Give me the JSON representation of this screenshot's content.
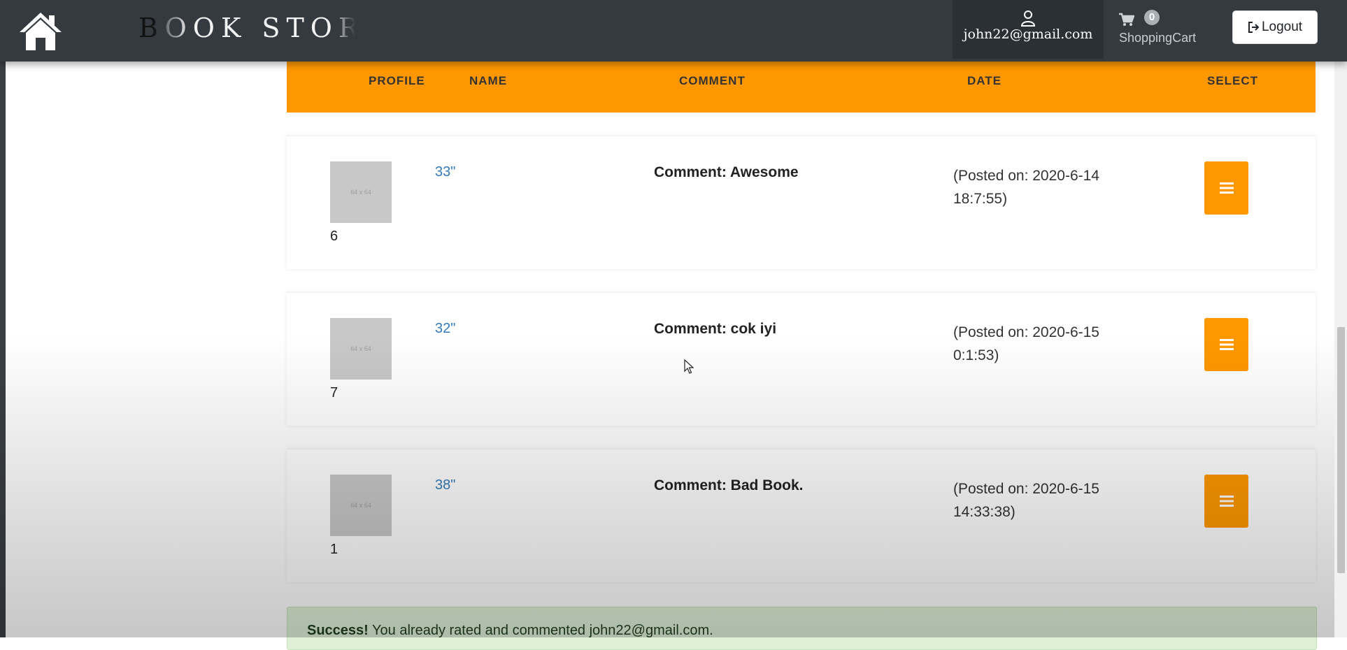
{
  "navbar": {
    "brand_first": "B",
    "brand_rest": "OOK STORE",
    "user_email": "john22@gmail.com",
    "cart_count": "0",
    "cart_label": "ShoppingCart",
    "logout_label": "Logout"
  },
  "table": {
    "headers": {
      "profile": "PROFILE",
      "name": "NAME",
      "comment": "COMMENT",
      "date": "DATE",
      "select": "SELECT"
    },
    "rows": [
      {
        "thumb": "64 x 64",
        "number": "6",
        "name": "33\"",
        "comment": "Comment: Awesome",
        "date": "(Posted on: 2020-6-14 18:7:55)"
      },
      {
        "thumb": "64 x 64",
        "number": "7",
        "name": "32\"",
        "comment": "Comment: cok iyi",
        "date": "(Posted on: 2020-6-15 0:1:53)"
      },
      {
        "thumb": "64 x 64",
        "number": "1",
        "name": "38\"",
        "comment": "Comment: Bad Book.",
        "date": "(Posted on: 2020-6-15 14:33:38)"
      }
    ]
  },
  "alert": {
    "strong": "Success!",
    "message": " You already rated and commented john22@gmail.com."
  },
  "colors": {
    "navbar": "#343a40",
    "accent": "#ff9800",
    "link": "#337ab7",
    "success_bg": "#dff0d8"
  },
  "icons": {
    "home": "home-icon",
    "user": "user-icon",
    "cart": "cart-icon",
    "logout": "logout-icon",
    "select": "menu-icon"
  }
}
